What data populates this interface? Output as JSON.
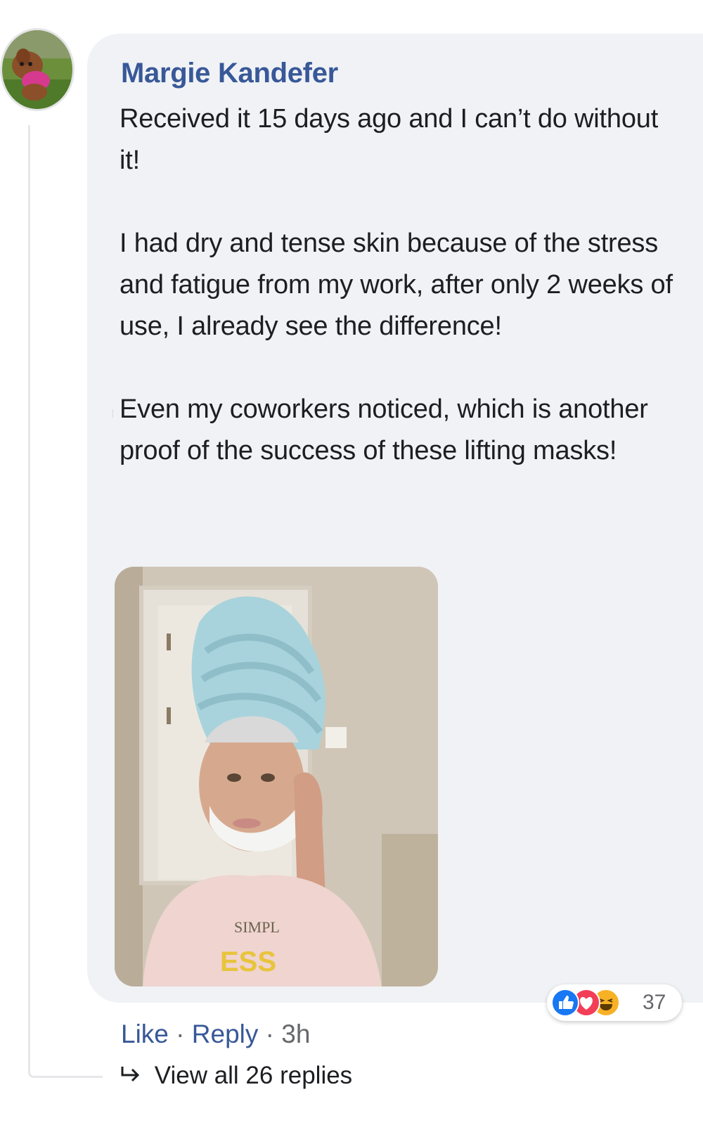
{
  "comment": {
    "author": "Margie Kandefer",
    "paragraphs": [
      "Received it 15 days ago and I can’t do without it!",
      "I had dry and tense skin because of the stress and fatigue from my work, after only 2 weeks of use, I already see the difference!",
      "Even my coworkers noticed, which is another proof of the success of these lifting masks!"
    ],
    "photo_shirt_text": [
      "SIMPL",
      "ESS"
    ]
  },
  "reactions": {
    "icons": [
      "like-icon",
      "love-icon",
      "haha-icon"
    ],
    "count": "37"
  },
  "actions": {
    "like": "Like",
    "separator": "·",
    "reply": "Reply",
    "time": "3h"
  },
  "replies": {
    "label": "View all 26 replies"
  },
  "colors": {
    "bubble": "#f0f2f5",
    "author": "#385898",
    "link": "#385898",
    "like_blue": "#1877f2",
    "love_red": "#f33e58",
    "haha_yellow": "#f7b125"
  }
}
